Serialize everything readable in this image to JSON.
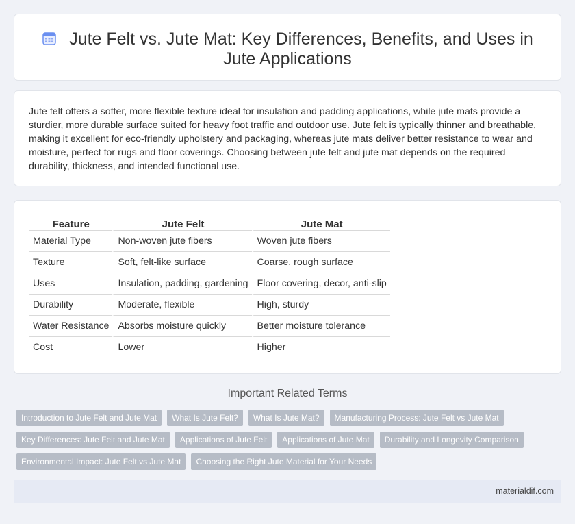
{
  "header": {
    "title": "Jute Felt vs. Jute Mat: Key Differences, Benefits, and Uses in Jute Applications",
    "icon": "calendar-icon",
    "icon_color": "#6a8ff0"
  },
  "intro": {
    "text": "Jute felt offers a softer, more flexible texture ideal for insulation and padding applications, while jute mats provide a sturdier, more durable surface suited for heavy foot traffic and outdoor use. Jute felt is typically thinner and breathable, making it excellent for eco-friendly upholstery and packaging, whereas jute mats deliver better resistance to wear and moisture, perfect for rugs and floor coverings. Choosing between jute felt and jute mat depends on the required durability, thickness, and intended functional use."
  },
  "table": {
    "headers": [
      "Feature",
      "Jute Felt",
      "Jute Mat"
    ],
    "rows": [
      [
        "Material Type",
        "Non-woven jute fibers",
        "Woven jute fibers"
      ],
      [
        "Texture",
        "Soft, felt-like surface",
        "Coarse, rough surface"
      ],
      [
        "Uses",
        "Insulation, padding, gardening",
        "Floor covering, decor, anti-slip"
      ],
      [
        "Durability",
        "Moderate, flexible",
        "High, sturdy"
      ],
      [
        "Water Resistance",
        "Absorbs moisture quickly",
        "Better moisture tolerance"
      ],
      [
        "Cost",
        "Lower",
        "Higher"
      ]
    ]
  },
  "related": {
    "title": "Important Related Terms",
    "rows": [
      [
        "Introduction to Jute Felt and Jute Mat",
        "What Is Jute Felt?",
        "What Is Jute Mat?",
        "Manufacturing Process: Jute Felt vs Jute Mat"
      ],
      [
        "Key Differences: Jute Felt and Jute Mat",
        "Applications of Jute Felt",
        "Applications of Jute Mat",
        "Durability and Longevity Comparison"
      ],
      [
        "Environmental Impact: Jute Felt vs Jute Mat",
        "Choosing the Right Jute Material for Your Needs"
      ]
    ]
  },
  "footer": {
    "site": "materialdif.com"
  }
}
